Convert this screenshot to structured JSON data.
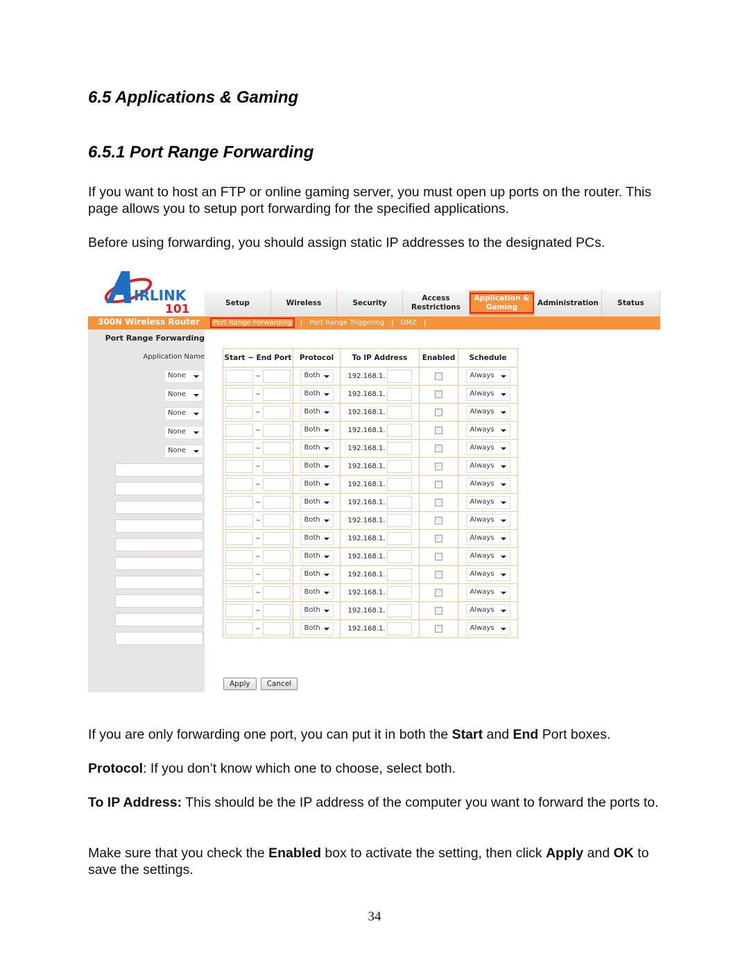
{
  "doc": {
    "heading_1": "6.5 Applications & Gaming",
    "heading_2": "6.5.1 Port Range Forwarding",
    "intro_1": "If you want to host an FTP or online gaming server, you must open up ports on the router.  This page allows you to setup port forwarding for the specified applications.",
    "intro_2": "Before using forwarding, you should assign static IP addresses to the designated PCs.",
    "p3": {
      "a": "If you are only forwarding one port, you can put it in both the ",
      "b1": "Start",
      "c": " and ",
      "b2": "End",
      "d": " Port boxes."
    },
    "p4": {
      "b": "Protocol",
      "t": ":  If you don’t know which one to choose, select both."
    },
    "p5": {
      "b": "To IP Address:",
      "t": "  This should be the IP address of the computer you want to forward the ports to."
    },
    "p6": {
      "a": "Make sure that you check the ",
      "b1": "Enabled",
      "c": " box to activate the setting, then click ",
      "b2": "Apply",
      "d": " and ",
      "b3": "OK",
      "e": " to save the settings."
    },
    "page_number": "34"
  },
  "router": {
    "logo": {
      "text": "IRLINK",
      "sub": "101"
    },
    "brand": "300N Wireless Router",
    "tabs": [
      {
        "label": "Setup",
        "active": false
      },
      {
        "label": "Wireless",
        "active": false
      },
      {
        "label": "Security",
        "active": false
      },
      {
        "label": "Access Restrictions",
        "active": false
      },
      {
        "label": "Application & Gaming",
        "active": true
      },
      {
        "label": "Administration",
        "active": false
      },
      {
        "label": "Status",
        "active": false
      }
    ],
    "subtabs": [
      {
        "label": "Port Range Forwarding",
        "active": true
      },
      {
        "label": "Port Range Triggering",
        "active": false
      },
      {
        "label": "DMZ",
        "active": false
      }
    ],
    "section_title": "Port Range Forwarding",
    "app_name_label": "Application Name",
    "columns": [
      "Start ~ End Port",
      "Protocol",
      "To IP Address",
      "Enabled",
      "Schedule"
    ],
    "tilde": "~",
    "ip_prefix": "192.168.1.",
    "protocol_value": "Both",
    "schedule_value": "Always",
    "preset_app_value": "None",
    "preset_rows": 5,
    "custom_rows": 10,
    "apply_label": "Apply",
    "cancel_label": "Cancel"
  },
  "colors": {
    "orange": "#f7943b",
    "highlight_red": "#e0262c",
    "logo_blue": "#1e6fc0",
    "logo_red": "#d71f26"
  }
}
